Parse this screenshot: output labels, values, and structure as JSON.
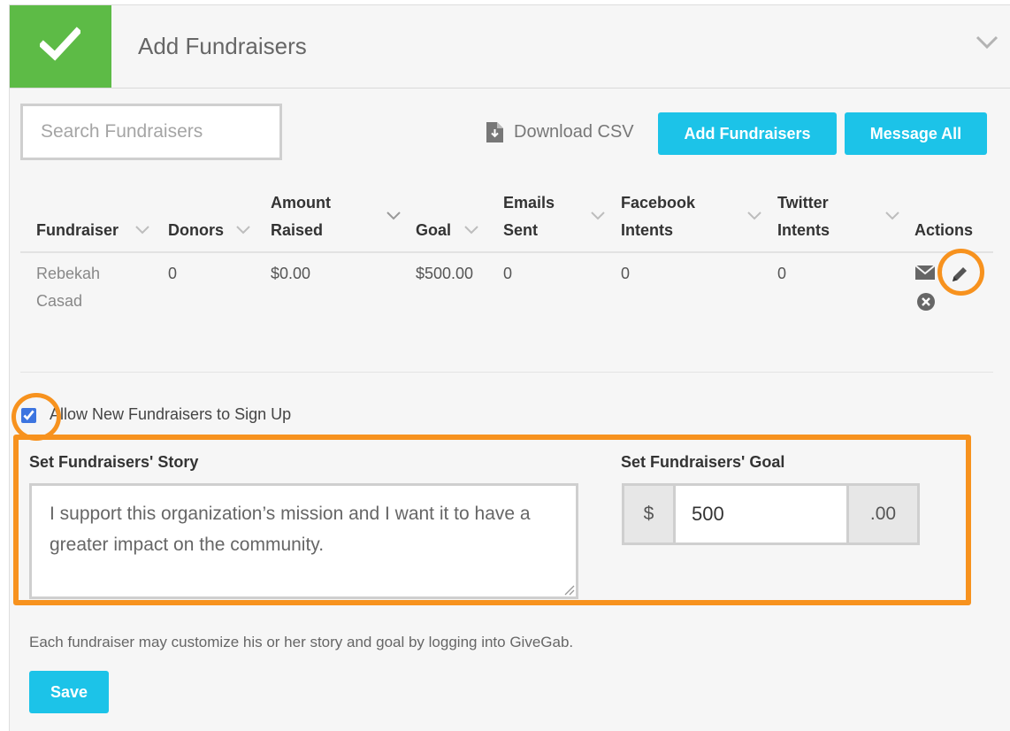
{
  "header": {
    "title": "Add Fundraisers"
  },
  "toolbar": {
    "search_placeholder": "Search Fundraisers",
    "download_csv": "Download CSV",
    "add_fundraisers": "Add Fundraisers",
    "message_all": "Message All"
  },
  "table": {
    "columns": [
      {
        "line1": "",
        "line2": "Fundraiser"
      },
      {
        "line1": "",
        "line2": "Donors"
      },
      {
        "line1": "Amount",
        "line2": "Raised"
      },
      {
        "line1": "",
        "line2": "Goal"
      },
      {
        "line1": "Emails",
        "line2": "Sent"
      },
      {
        "line1": "Facebook",
        "line2": "Intents"
      },
      {
        "line1": "Twitter",
        "line2": "Intents"
      },
      {
        "line1": "",
        "line2": "Actions"
      }
    ],
    "rows": [
      {
        "fundraiser_line1": "Rebekah",
        "fundraiser_line2": "Casad",
        "donors": "0",
        "amount_raised": "$0.00",
        "goal": "$500.00",
        "emails_sent": "0",
        "facebook_intents": "0",
        "twitter_intents": "0"
      }
    ]
  },
  "signup": {
    "label": "Allow New Fundraisers to Sign Up",
    "checked": true
  },
  "story": {
    "label": "Set Fundraisers' Story",
    "value": "I support this organization’s mission and I want it to have a greater impact on the community."
  },
  "goal": {
    "label": "Set Fundraisers' Goal",
    "prefix": "$",
    "value": "500",
    "suffix": ".00"
  },
  "note": "Each fundraiser may customize his or her story and goal by logging into GiveGab.",
  "save_label": "Save",
  "colors": {
    "accent": "#1cc3e8",
    "success": "#5dbb46",
    "highlight": "#f7921e"
  }
}
